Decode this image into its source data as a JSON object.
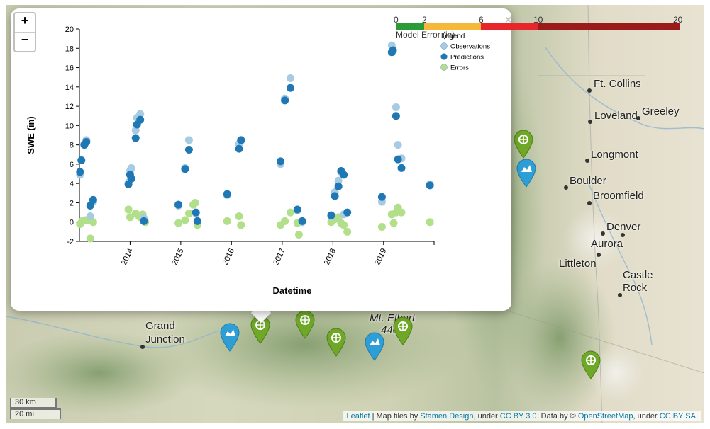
{
  "zoom": {
    "in_label": "+",
    "out_label": "−"
  },
  "popup": {
    "close_label": "×"
  },
  "chart_data": {
    "type": "scatter",
    "xlabel": "Datetime",
    "ylabel": "SWE (in)",
    "ylim": [
      -2,
      20
    ],
    "yticks": [
      -2,
      0,
      2,
      4,
      6,
      8,
      10,
      12,
      14,
      16,
      18,
      20
    ],
    "xlim": [
      "2013-01-01",
      "2019-12-31"
    ],
    "xticks": [
      "2014",
      "2015",
      "2016",
      "2017",
      "2018",
      "2019"
    ],
    "legend": {
      "title": "Legend",
      "placement": "top-right"
    },
    "series": [
      {
        "name": "Observations",
        "color": "#a6cbe3",
        "points": [
          [
            "2013-01-05",
            4.9
          ],
          [
            "2013-01-15",
            6.4
          ],
          [
            "2013-02-05",
            8.1
          ],
          [
            "2013-02-20",
            8.5
          ],
          [
            "2013-03-20",
            0.6
          ],
          [
            "2013-04-10",
            2.1
          ],
          [
            "2013-12-20",
            4.1
          ],
          [
            "2014-01-01",
            5.3
          ],
          [
            "2014-01-10",
            5.6
          ],
          [
            "2014-02-10",
            9.5
          ],
          [
            "2014-02-20",
            10.8
          ],
          [
            "2014-03-15",
            11.2
          ],
          [
            "2014-04-10",
            0.4
          ],
          [
            "2014-12-15",
            1.7
          ],
          [
            "2015-02-01",
            5.6
          ],
          [
            "2015-03-01",
            8.5
          ],
          [
            "2015-04-20",
            0.9
          ],
          [
            "2015-12-01",
            2.8
          ],
          [
            "2016-02-25",
            8.1
          ],
          [
            "2016-03-10",
            8.4
          ],
          [
            "2016-12-20",
            6.0
          ],
          [
            "2017-01-20",
            12.8
          ],
          [
            "2017-03-01",
            14.9
          ],
          [
            "2017-04-20",
            1.2
          ],
          [
            "2017-05-25",
            0.0
          ],
          [
            "2017-12-20",
            0.6
          ],
          [
            "2018-01-15",
            3.1
          ],
          [
            "2018-02-10",
            4.3
          ],
          [
            "2018-03-01",
            5.2
          ],
          [
            "2018-03-20",
            0.8
          ],
          [
            "2018-12-20",
            2.1
          ],
          [
            "2019-03-01",
            18.3
          ],
          [
            "2019-04-01",
            11.9
          ],
          [
            "2019-04-15",
            8.0
          ],
          [
            "2019-05-10",
            6.6
          ],
          [
            "2019-12-01",
            3.9
          ]
        ]
      },
      {
        "name": "Predictions",
        "color": "#1f78b4",
        "points": [
          [
            "2013-01-05",
            5.2
          ],
          [
            "2013-01-15",
            6.4
          ],
          [
            "2013-02-05",
            8.0
          ],
          [
            "2013-02-20",
            8.3
          ],
          [
            "2013-03-20",
            1.7
          ],
          [
            "2013-04-10",
            2.3
          ],
          [
            "2013-12-20",
            3.9
          ],
          [
            "2014-01-01",
            4.9
          ],
          [
            "2014-01-10",
            4.5
          ],
          [
            "2014-02-10",
            8.7
          ],
          [
            "2014-02-20",
            10.1
          ],
          [
            "2014-03-15",
            10.6
          ],
          [
            "2014-04-10",
            0.1
          ],
          [
            "2014-12-15",
            1.8
          ],
          [
            "2015-02-01",
            5.5
          ],
          [
            "2015-03-01",
            7.5
          ],
          [
            "2015-04-20",
            1.0
          ],
          [
            "2015-05-01",
            0.1
          ],
          [
            "2015-12-01",
            2.9
          ],
          [
            "2016-02-25",
            7.6
          ],
          [
            "2016-03-10",
            8.5
          ],
          [
            "2016-12-20",
            6.3
          ],
          [
            "2017-01-20",
            12.6
          ],
          [
            "2017-03-01",
            13.9
          ],
          [
            "2017-04-20",
            1.3
          ],
          [
            "2017-05-25",
            0.1
          ],
          [
            "2017-12-20",
            0.7
          ],
          [
            "2018-01-15",
            2.7
          ],
          [
            "2018-02-10",
            3.7
          ],
          [
            "2018-03-01",
            5.3
          ],
          [
            "2018-03-20",
            4.9
          ],
          [
            "2018-04-15",
            1.0
          ],
          [
            "2018-12-20",
            2.6
          ],
          [
            "2019-03-01",
            17.6
          ],
          [
            "2019-03-10",
            17.8
          ],
          [
            "2019-04-01",
            11.0
          ],
          [
            "2019-04-15",
            6.5
          ],
          [
            "2019-05-10",
            5.6
          ],
          [
            "2019-12-01",
            3.8
          ]
        ]
      },
      {
        "name": "Errors",
        "color": "#b2df8a",
        "points": [
          [
            "2013-01-05",
            -0.2
          ],
          [
            "2013-01-20",
            0.1
          ],
          [
            "2013-02-10",
            0.2
          ],
          [
            "2013-03-01",
            0.2
          ],
          [
            "2013-03-20",
            -1.7
          ],
          [
            "2013-04-10",
            0.0
          ],
          [
            "2013-12-20",
            1.3
          ],
          [
            "2014-01-01",
            0.5
          ],
          [
            "2014-02-10",
            0.9
          ],
          [
            "2014-03-01",
            0.7
          ],
          [
            "2014-03-15",
            0.5
          ],
          [
            "2014-04-01",
            0.8
          ],
          [
            "2014-04-20",
            0.0
          ],
          [
            "2014-12-15",
            -0.1
          ],
          [
            "2015-02-01",
            0.2
          ],
          [
            "2015-03-01",
            0.9
          ],
          [
            "2015-04-01",
            1.8
          ],
          [
            "2015-04-15",
            2.0
          ],
          [
            "2015-05-01",
            -0.3
          ],
          [
            "2015-12-01",
            0.1
          ],
          [
            "2016-02-25",
            0.6
          ],
          [
            "2016-03-10",
            -0.3
          ],
          [
            "2016-12-20",
            -0.3
          ],
          [
            "2017-01-20",
            0.1
          ],
          [
            "2017-03-01",
            1.0
          ],
          [
            "2017-04-20",
            -0.1
          ],
          [
            "2017-05-01",
            -1.3
          ],
          [
            "2017-05-25",
            0.0
          ],
          [
            "2017-12-20",
            0.0
          ],
          [
            "2018-01-15",
            0.3
          ],
          [
            "2018-02-10",
            0.5
          ],
          [
            "2018-03-01",
            -0.1
          ],
          [
            "2018-03-20",
            -0.3
          ],
          [
            "2018-04-15",
            -1.0
          ],
          [
            "2018-12-20",
            -0.5
          ],
          [
            "2019-03-01",
            0.8
          ],
          [
            "2019-03-15",
            -0.1
          ],
          [
            "2019-04-01",
            1.0
          ],
          [
            "2019-04-15",
            1.5
          ],
          [
            "2019-05-10",
            1.0
          ],
          [
            "2019-12-01",
            0.0
          ]
        ]
      }
    ]
  },
  "error_scale": {
    "title": "Model Error (in)",
    "max": 20,
    "ticks": [
      0,
      2,
      6,
      10,
      20
    ],
    "bands": [
      {
        "from": 0,
        "to": 2,
        "color": "#2a9b38"
      },
      {
        "from": 2,
        "to": 6,
        "color": "#f5b83a"
      },
      {
        "from": 6,
        "to": 10,
        "color": "#e8252b"
      },
      {
        "from": 10,
        "to": 20,
        "color": "#9b1a1a"
      }
    ]
  },
  "places": [
    {
      "name": "Ft. Collins"
    },
    {
      "name": "Loveland"
    },
    {
      "name": "Greeley"
    },
    {
      "name": "Longmont"
    },
    {
      "name": "Boulder"
    },
    {
      "name": "Broomfield"
    },
    {
      "name": "Denver"
    },
    {
      "name": "Aurora"
    },
    {
      "name": "Littleton"
    },
    {
      "name": "Castle"
    },
    {
      "name": "Rock"
    },
    {
      "name": "Grand"
    },
    {
      "name": "Junction"
    },
    {
      "name": "Mt. Elbert"
    },
    {
      "name": "440"
    }
  ],
  "markers": {
    "green_color": "#6fa827",
    "blue_color": "#2e9fd6",
    "green_icon": "snowflake-icon",
    "blue_icon": "chart-icon"
  },
  "scale": {
    "km": "30 km",
    "mi": "20 mi"
  },
  "attribution": {
    "leaflet": "Leaflet",
    "sep1": " | Map tiles by ",
    "stamen": "Stamen Design",
    "sep2": ", under ",
    "ccby": "CC BY 3.0",
    "sep3": ". Data by © ",
    "osm": "OpenStreetMap",
    "sep4": ", under ",
    "ccbysa": "CC BY SA",
    "end": "."
  }
}
